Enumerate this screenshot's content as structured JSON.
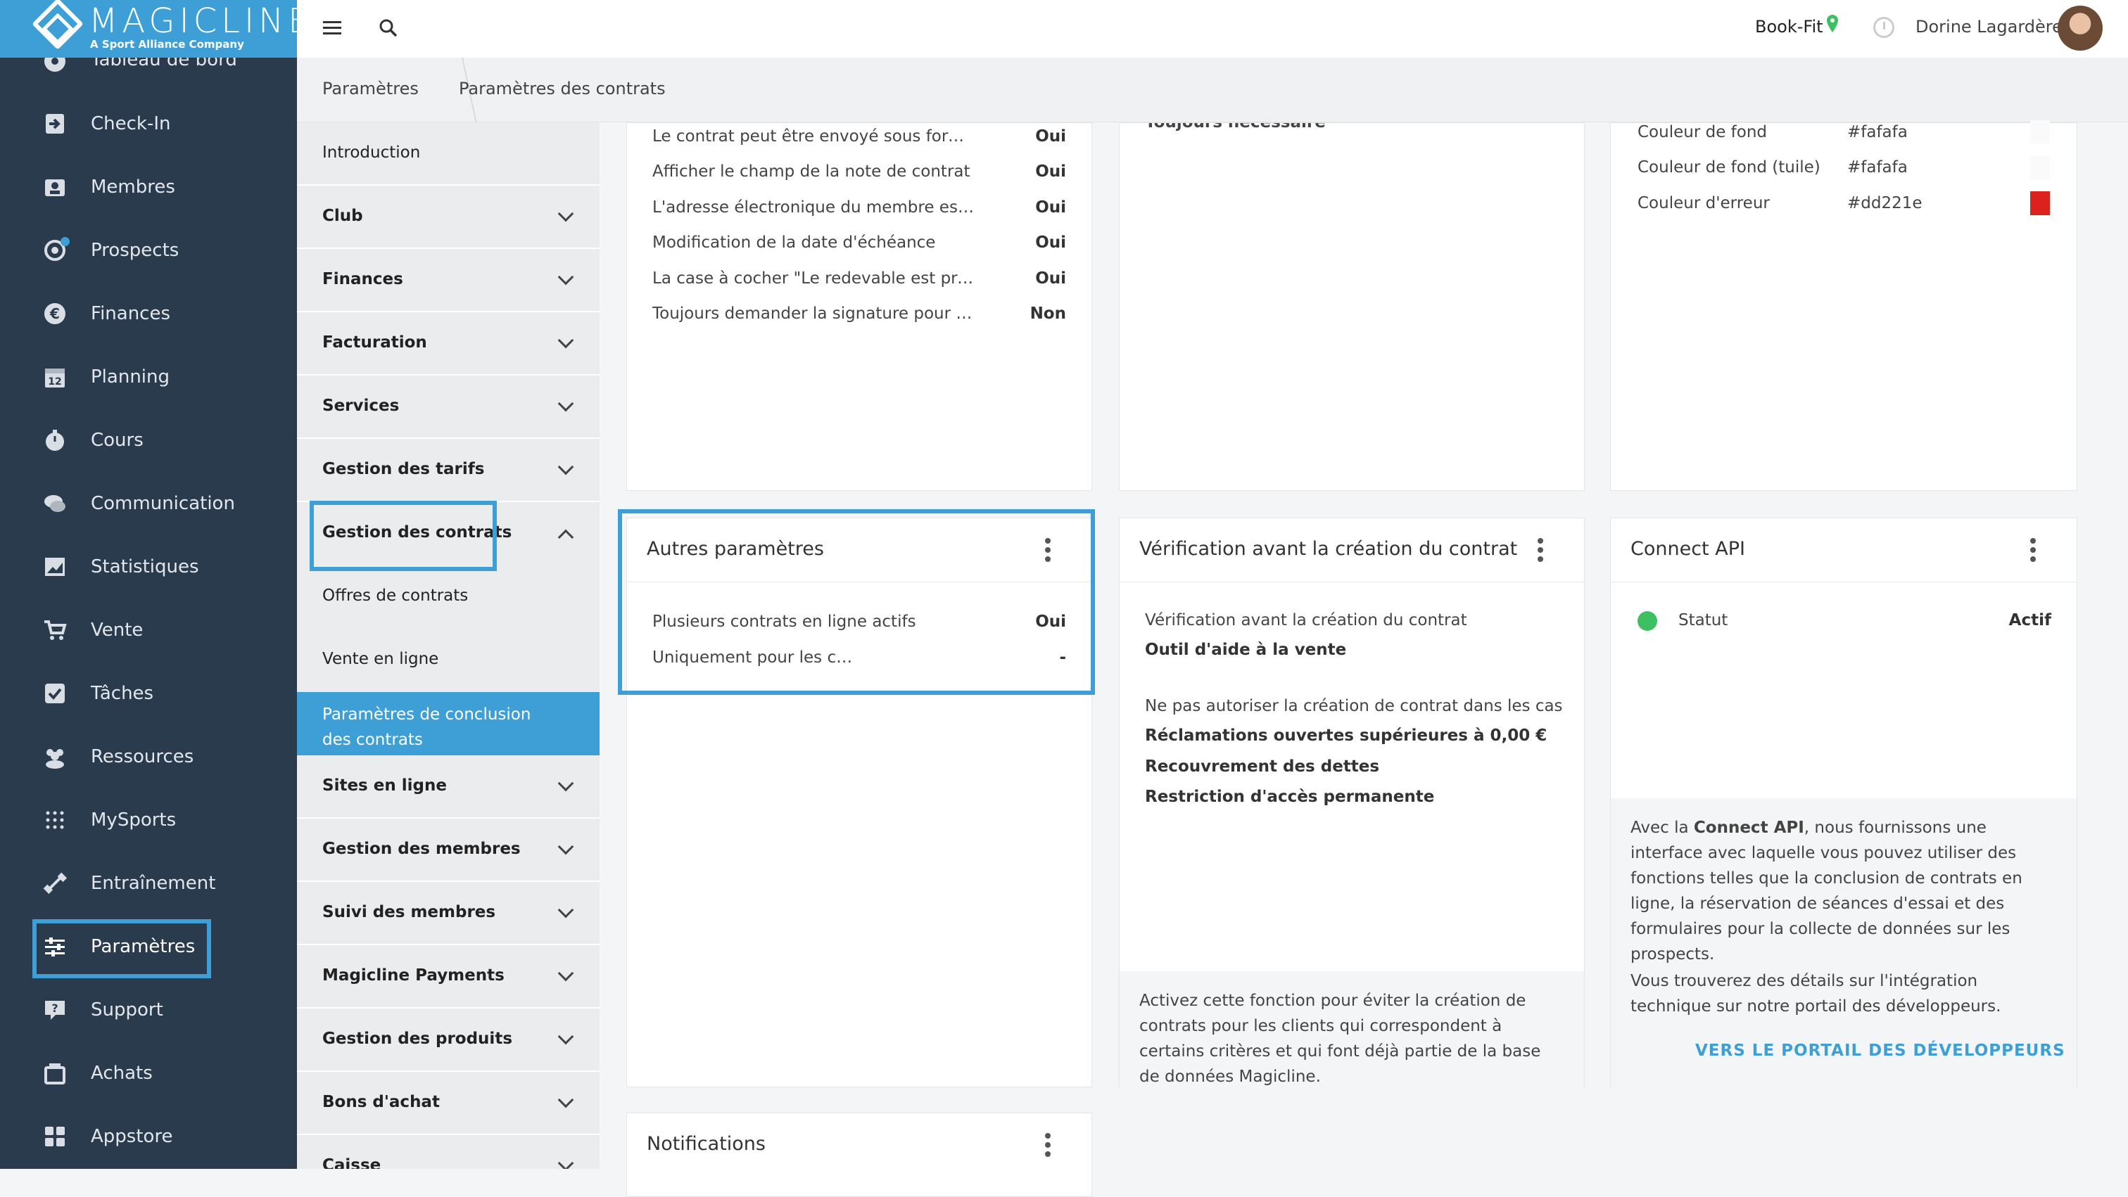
{
  "brand": {
    "name": "MAGICLINE",
    "tagline": "A Sport Alliance Company"
  },
  "sidebar": {
    "items": [
      {
        "label": "Tableau de bord",
        "icon": "dashboard-icon"
      },
      {
        "label": "Check-In",
        "icon": "check-in-icon"
      },
      {
        "label": "Membres",
        "icon": "members-icon"
      },
      {
        "label": "Prospects",
        "icon": "prospects-icon"
      },
      {
        "label": "Finances",
        "icon": "euro-icon"
      },
      {
        "label": "Planning",
        "icon": "calendar-icon",
        "badge": "12"
      },
      {
        "label": "Cours",
        "icon": "stopwatch-icon"
      },
      {
        "label": "Communication",
        "icon": "chat-icon"
      },
      {
        "label": "Statistiques",
        "icon": "chart-icon"
      },
      {
        "label": "Vente",
        "icon": "cart-icon"
      },
      {
        "label": "Tâches",
        "icon": "checkbox-icon"
      },
      {
        "label": "Ressources",
        "icon": "people-icon"
      },
      {
        "label": "MySports",
        "icon": "dots-grid-icon"
      },
      {
        "label": "Entraînement",
        "icon": "dumbbell-icon"
      },
      {
        "label": "Paramètres",
        "icon": "sliders-icon"
      },
      {
        "label": "Support",
        "icon": "help-icon"
      },
      {
        "label": "Achats",
        "icon": "bag-icon"
      },
      {
        "label": "Appstore",
        "icon": "apps-icon"
      }
    ]
  },
  "header": {
    "club": "Book-Fit",
    "user": "Dorine Lagardère"
  },
  "breadcrumb": [
    "Paramètres",
    "Paramètres des contrats"
  ],
  "submenu": {
    "items": [
      {
        "label": "Introduction"
      },
      {
        "label": "Club"
      },
      {
        "label": "Finances"
      },
      {
        "label": "Facturation"
      },
      {
        "label": "Services"
      },
      {
        "label": "Gestion des tarifs"
      },
      {
        "label": "Gestion des contrats"
      },
      {
        "label": "Sites en ligne"
      },
      {
        "label": "Gestion des membres"
      },
      {
        "label": "Suivi des membres"
      },
      {
        "label": "Magicline Payments"
      },
      {
        "label": "Gestion des produits"
      },
      {
        "label": "Bons d'achat"
      },
      {
        "label": "Caisse"
      }
    ],
    "children": [
      {
        "label": "Offres de contrats"
      },
      {
        "label": "Vente en ligne"
      },
      {
        "label": "Paramètres de conclusion des contrats"
      }
    ]
  },
  "card_general": {
    "rows": [
      {
        "key": "Le contrat peut être envoyé sous forme …",
        "value": "Oui"
      },
      {
        "key": "Afficher le champ de la note de contrat",
        "value": "Oui"
      },
      {
        "key": "L'adresse électronique du membre est …",
        "value": "Oui"
      },
      {
        "key": "Modification de la date d'échéance",
        "value": "Oui"
      },
      {
        "key": "La case à cocher \"Le redevable est prés…",
        "value": "Oui"
      },
      {
        "key": "Toujours demander la signature pour le…",
        "value": "Non"
      }
    ]
  },
  "card_signature": {
    "partial_text": "Toujours nécessaire"
  },
  "card_colors": {
    "rows": [
      {
        "key": "Couleur de fond",
        "value": "#fafafa",
        "swatch": "#fafafa"
      },
      {
        "key": "Couleur de fond (tuile)",
        "value": "#fafafa",
        "swatch": "#fafafa"
      },
      {
        "key": "Couleur d'erreur",
        "value": "#dd221e",
        "swatch": "#dd221e"
      }
    ]
  },
  "card_other": {
    "title": "Autres paramètres",
    "rows": [
      {
        "key": "Plusieurs contrats en ligne actifs",
        "value": "Oui"
      },
      {
        "key": "Uniquement pour les c…",
        "value": "-"
      }
    ]
  },
  "card_check": {
    "title": "Vérification avant la création du contrat",
    "line1": "Vérification avant la création du contrat",
    "line1_bold": "Outil d'aide à la vente",
    "line2": "Ne pas autoriser la création de contrat dans les cas su…",
    "bold_lines": [
      "Réclamations ouvertes supérieures à 0,00 €",
      "Recouvrement des dettes",
      "Restriction d'accès permanente"
    ],
    "footer": "Activez cette fonction pour éviter la création de contrats pour les clients qui correspondent à certains critères et qui font déjà partie de la base de données Magicline."
  },
  "card_api": {
    "title": "Connect API",
    "status_label": "Statut",
    "status_value": "Actif",
    "desc_pre": "Avec la ",
    "desc_bold": "Connect API",
    "desc_post": ", nous fournissons une interface avec laquelle vous pouvez utiliser des fonctions telles que la conclusion de contrats en ligne, la réservation de séances d'essai et des formulaires pour la collecte de données sur les prospects.",
    "desc2": "Vous trouverez des détails sur l'intégration technique sur notre portail des développeurs.",
    "link": "VERS LE PORTAIL DES DÉVELOPPEURS"
  },
  "card_notifications": {
    "title": "Notifications"
  },
  "colors": {
    "accent": "#3d9fd6",
    "sidebar": "#2b3b4e",
    "status_ok": "#3cc061"
  }
}
